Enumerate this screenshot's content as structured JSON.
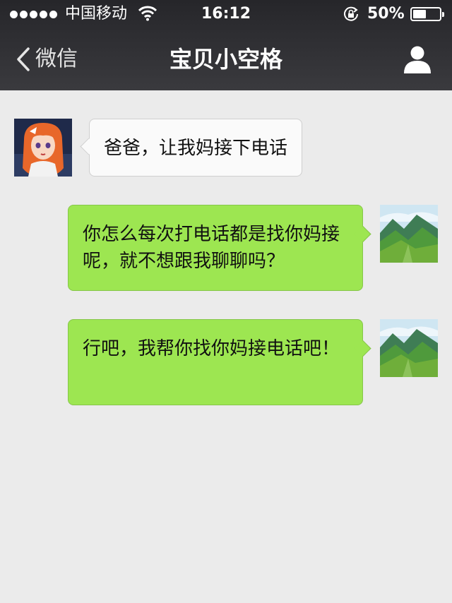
{
  "status_bar": {
    "carrier": "中国移动",
    "time": "16:12",
    "battery_percent_text": "50%",
    "battery_level": 0.5,
    "signal_bars": 5,
    "icons": [
      "signal-dots-icon",
      "wifi-icon",
      "rotation-lock-icon",
      "battery-icon"
    ]
  },
  "nav": {
    "back_label": "微信",
    "title": "宝贝小空格",
    "icons": {
      "back": "chevron-left-icon",
      "profile": "person-icon"
    },
    "bar_color": "#2f2f33"
  },
  "messages": [
    {
      "side": "incoming",
      "avatar": "girl-cartoon-avatar",
      "text": "爸爸，让我妈接下电话"
    },
    {
      "side": "outgoing",
      "avatar": "mountain-landscape-avatar",
      "text": "你怎么每次打电话都是找你妈接呢，就不想跟我聊聊吗？"
    },
    {
      "side": "outgoing",
      "avatar": "mountain-landscape-avatar",
      "text": "行吧，我帮你找你妈接电话吧！"
    }
  ],
  "colors": {
    "background": "#ebebeb",
    "outgoing_bubble": "#9de651",
    "incoming_bubble": "#fafafa"
  }
}
